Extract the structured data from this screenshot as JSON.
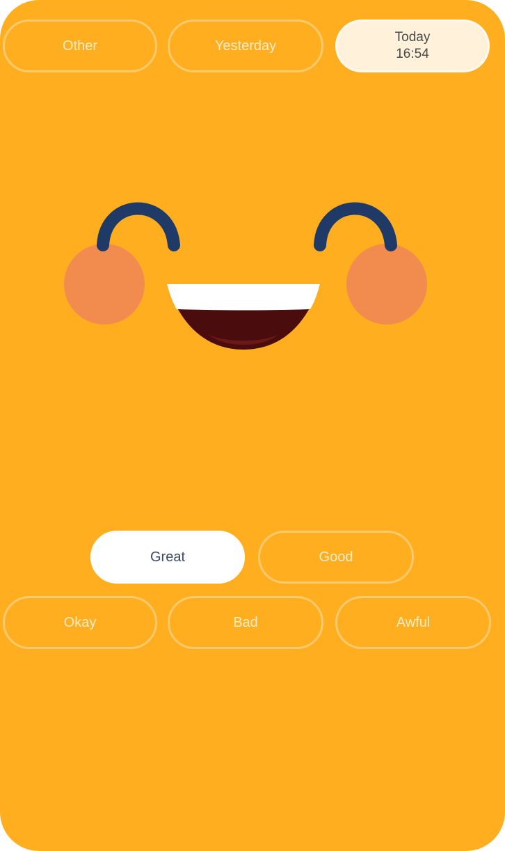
{
  "colors": {
    "background": "#FFAE20",
    "eye": "#1F3A66",
    "cheek": "#F28C4E",
    "mouth_dark": "#4A0C0C",
    "teeth": "#FFFFFF"
  },
  "date_tabs": [
    {
      "label": "Other",
      "selected": false
    },
    {
      "label": "Yesterday",
      "selected": false
    },
    {
      "label": "Today",
      "time": "16:54",
      "selected": true
    }
  ],
  "face": {
    "icon": "happy-face-icon",
    "expression": "great"
  },
  "mood_options": [
    {
      "label": "Great",
      "selected": true
    },
    {
      "label": "Good",
      "selected": false
    },
    {
      "label": "Okay",
      "selected": false
    },
    {
      "label": "Bad",
      "selected": false
    },
    {
      "label": "Awful",
      "selected": false
    }
  ]
}
